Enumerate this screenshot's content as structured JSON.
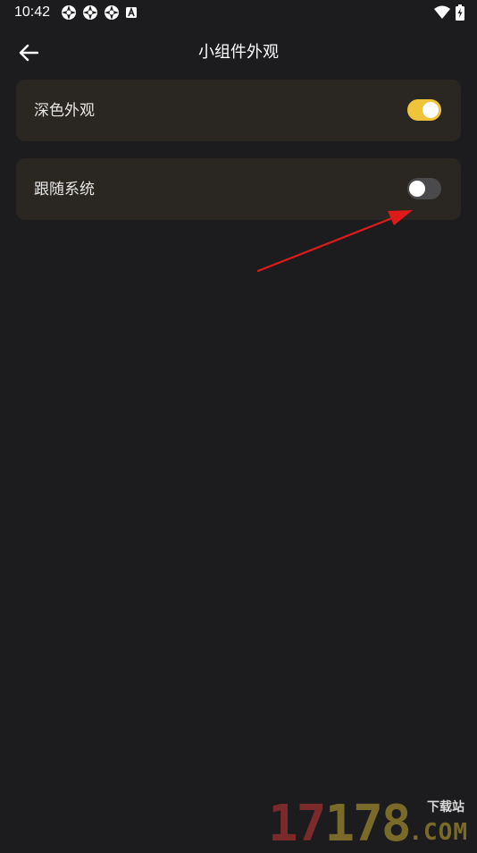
{
  "status_bar": {
    "time": "10:42",
    "icons_left": [
      "app-notification-icon",
      "app-notification-icon",
      "app-notification-icon",
      "a-keyboard-icon"
    ],
    "icons_right": [
      "wifi-icon",
      "battery-charging-icon"
    ]
  },
  "header": {
    "back_icon": "arrow-left-icon",
    "title": "小组件外观"
  },
  "settings": {
    "dark_appearance": {
      "label": "深色外观",
      "enabled": true
    },
    "follow_system": {
      "label": "跟随系统",
      "enabled": false
    }
  },
  "colors": {
    "background": "#1c1c1e",
    "card": "#2a2622",
    "toggle_on": "#f0c43a",
    "toggle_off": "#4a4a4c",
    "annotation_arrow": "#e01a1a"
  },
  "watermark": {
    "number_part1": "17",
    "number_part2": "178",
    "site_label": "下载站",
    "domain_suffix": ".COM"
  }
}
